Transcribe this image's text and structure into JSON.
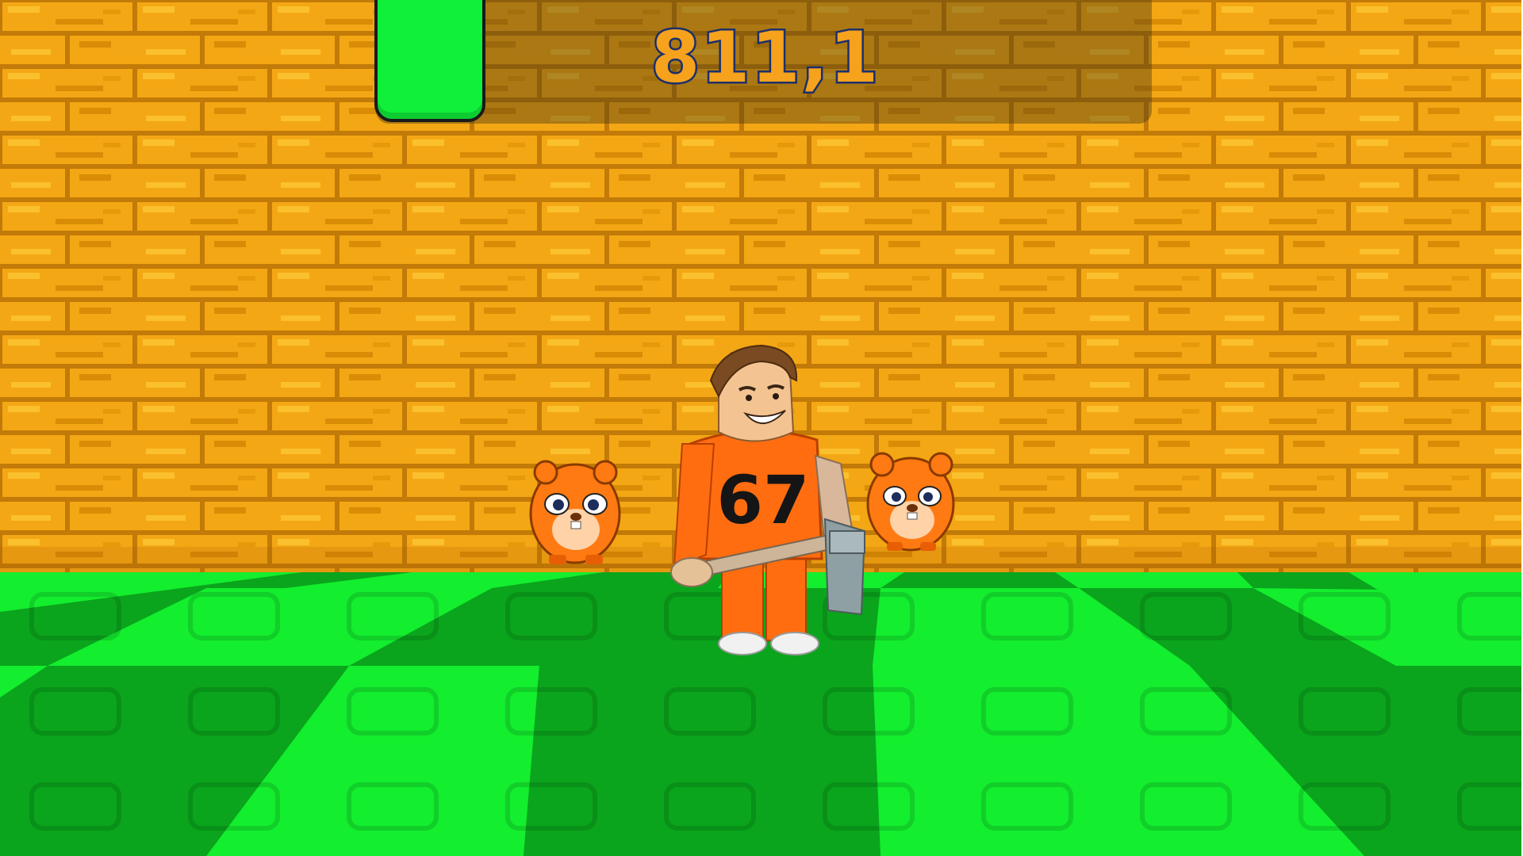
{
  "hud": {
    "counter_value": "811,1",
    "progress_icon": "green-progress-block"
  },
  "scene": {
    "wall": {
      "name": "brick-wall",
      "colors": {
        "base": "#f0a010",
        "light": "#fbbf26",
        "mortar": "#c27a08",
        "dark": "#d68b05"
      }
    },
    "floor": {
      "name": "checkered-floor",
      "colors": {
        "light": "#13ee2e",
        "dark": "#0aa51c",
        "line": "#078f16"
      }
    },
    "player": {
      "name": "prisoner-character",
      "jersey_number": "67",
      "colors": {
        "shirt": "#ff6d10",
        "shirt_dark": "#e2540a",
        "hair": "#7a4a22",
        "skin": "#f3c391",
        "shoe": "#f1f1f1"
      }
    },
    "pets": [
      {
        "name": "orange-hamster-pet-left",
        "color": "#ff7a12"
      },
      {
        "name": "orange-hamster-pet-right",
        "color": "#ff7a12"
      }
    ],
    "tool": {
      "name": "pickaxe-tool",
      "colors": {
        "handle": "#cdb59a",
        "head": "#8fa0a4"
      }
    }
  }
}
